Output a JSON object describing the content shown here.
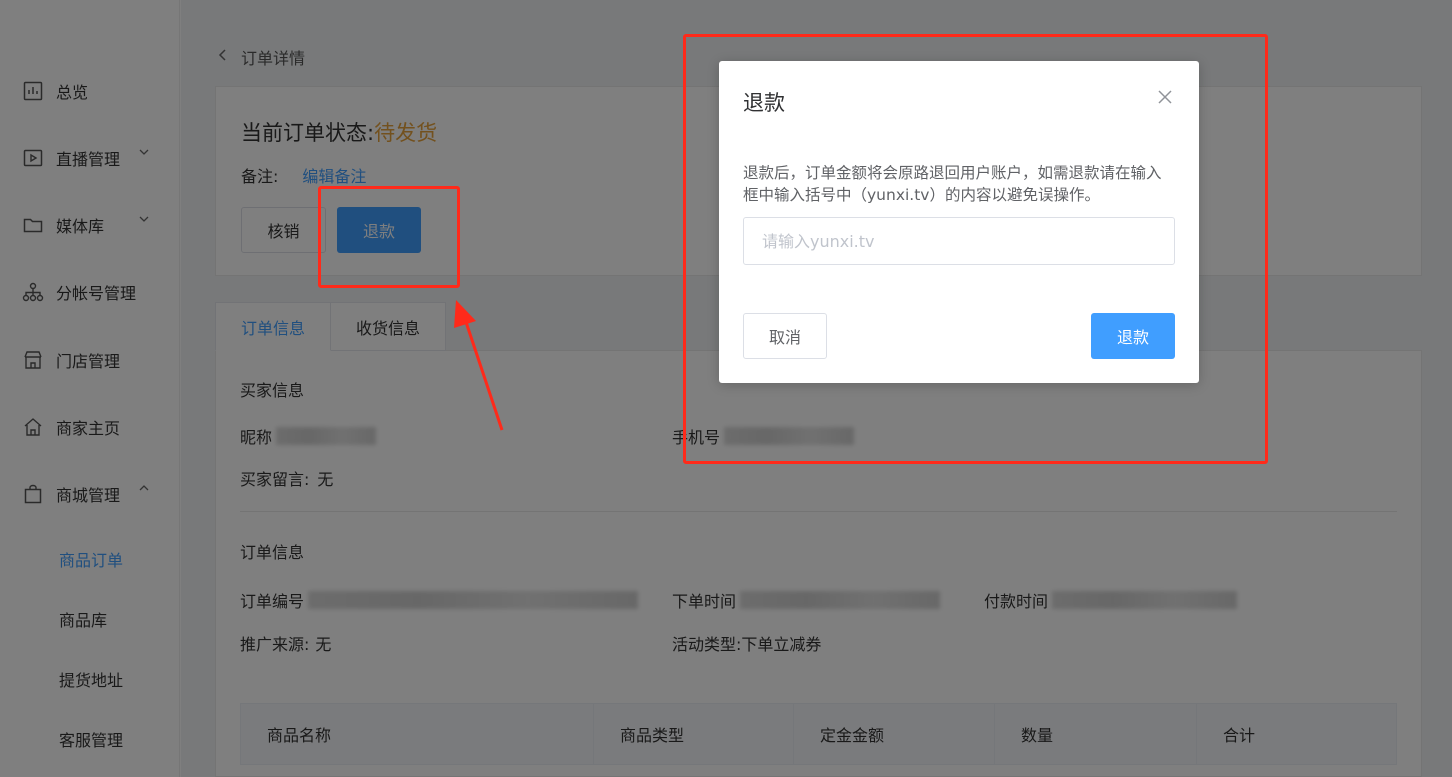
{
  "sidebar": {
    "items": [
      {
        "label": "总览",
        "icon": "chart-icon"
      },
      {
        "label": "直播管理",
        "icon": "live-icon"
      },
      {
        "label": "媒体库",
        "icon": "folder-icon"
      },
      {
        "label": "分帐号管理",
        "icon": "org-icon"
      },
      {
        "label": "门店管理",
        "icon": "store-icon"
      },
      {
        "label": "商家主页",
        "icon": "home-icon"
      },
      {
        "label": "商城管理",
        "icon": "bag-icon"
      }
    ],
    "sub_items": [
      {
        "label": "商品订单",
        "active": true
      },
      {
        "label": "商品库"
      },
      {
        "label": "提货地址"
      },
      {
        "label": "客服管理"
      }
    ]
  },
  "breadcrumb": {
    "title": "订单详情"
  },
  "order": {
    "status_label": "当前订单状态:",
    "status_value": "待发货",
    "remark_label": "备注:",
    "remark_link": "编辑备注",
    "verify_button": "核销",
    "refund_button": "退款"
  },
  "tabs": [
    {
      "label": "订单信息",
      "active": true
    },
    {
      "label": "收货信息"
    }
  ],
  "buyer": {
    "title": "买家信息",
    "nickname_label": "昵称",
    "phone_label": "手机号",
    "message_label": "买家留言:",
    "message_value": "无"
  },
  "order_info": {
    "title": "订单信息",
    "number_label": "订单编号",
    "order_time_label": "下单时间",
    "pay_time_label": "付款时间",
    "source_label": "推广来源:",
    "source_value": "无",
    "activity_label": "活动类型:",
    "activity_value": "下单立减券"
  },
  "table": {
    "headers": [
      "商品名称",
      "商品类型",
      "定金金额",
      "数量",
      "合计"
    ]
  },
  "modal": {
    "title": "退款",
    "message": "退款后，订单金额将会原路退回用户账户，如需退款请在输入框中输入括号中（yunxi.tv）的内容以避免误操作。",
    "input_placeholder": "请输入yunxi.tv",
    "cancel_button": "取消",
    "confirm_button": "退款"
  },
  "colors": {
    "accent": "#409eff",
    "status": "#e6a23c",
    "annotation": "#ff2a1a",
    "overlay": "rgba(0,0,0,0.5)"
  }
}
